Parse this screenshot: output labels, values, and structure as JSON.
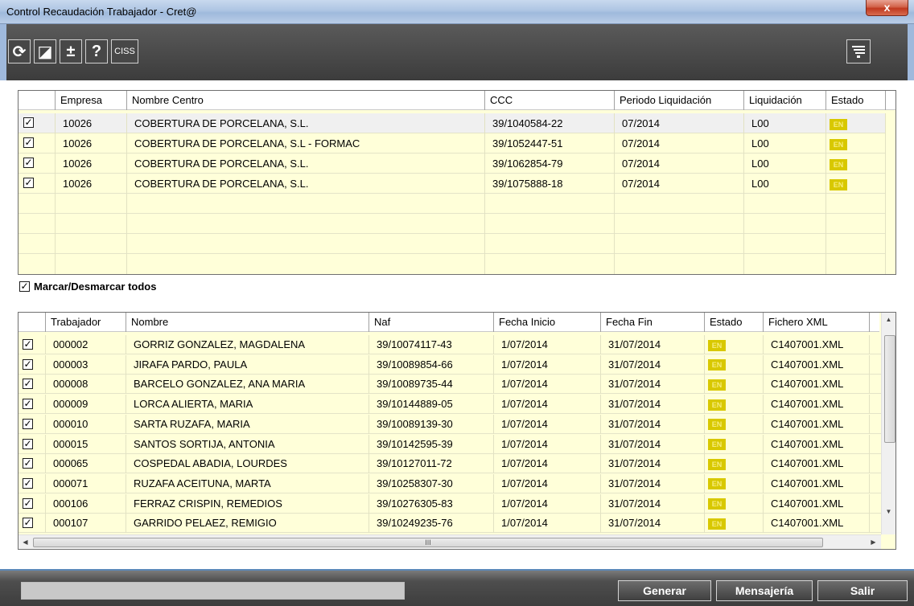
{
  "window": {
    "title": "Control Recaudación Trabajador - Cret@",
    "close_glyph": "x"
  },
  "toolbar": {
    "buttons": [
      {
        "icon": "refresh-icon",
        "glyph": "⟳"
      },
      {
        "icon": "edit-icon",
        "glyph": "◪"
      },
      {
        "icon": "plus-minus-icon",
        "glyph": "±"
      },
      {
        "icon": "help-icon",
        "glyph": "?"
      },
      {
        "icon": "ciss-icon",
        "glyph": "CISS"
      }
    ],
    "right_icon": "filter-icon"
  },
  "centers_grid": {
    "columns": [
      "Empresa",
      "Nombre Centro",
      "CCC",
      "Periodo Liquidación",
      "Liquidación",
      "Estado"
    ],
    "rows": [
      {
        "checked": true,
        "empresa": "10026",
        "nombre": "COBERTURA DE PORCELANA, S.L.",
        "ccc": "39/1040584-22",
        "periodo": "07/2014",
        "liquidacion": "L00",
        "estado": "EN"
      },
      {
        "checked": true,
        "empresa": "10026",
        "nombre": "COBERTURA DE PORCELANA, S.L - FORMAC",
        "ccc": "39/1052447-51",
        "periodo": "07/2014",
        "liquidacion": "L00",
        "estado": "EN"
      },
      {
        "checked": true,
        "empresa": "10026",
        "nombre": "COBERTURA DE PORCELANA, S.L.",
        "ccc": "39/1062854-79",
        "periodo": "07/2014",
        "liquidacion": "L00",
        "estado": "EN"
      },
      {
        "checked": true,
        "empresa": "10026",
        "nombre": "COBERTURA DE PORCELANA, S.L.",
        "ccc": "39/1075888-18",
        "periodo": "07/2014",
        "liquidacion": "L00",
        "estado": "EN"
      }
    ]
  },
  "marcar": {
    "label": "Marcar/Desmarcar todos",
    "checked": true
  },
  "workers_grid": {
    "columns": [
      "Trabajador",
      "Nombre",
      "Naf",
      "Fecha Inicio",
      "Fecha Fin",
      "Estado",
      "Fichero XML"
    ],
    "rows": [
      {
        "checked": true,
        "trabajador": "000002",
        "nombre": "GORRIZ GONZALEZ, MAGDALENA",
        "naf": "39/10074117-43",
        "inicio": "1/07/2014",
        "fin": "31/07/2014",
        "estado": "EN",
        "xml": "C1407001.XML"
      },
      {
        "checked": true,
        "trabajador": "000003",
        "nombre": "JIRAFA PARDO, PAULA",
        "naf": "39/10089854-66",
        "inicio": "1/07/2014",
        "fin": "31/07/2014",
        "estado": "EN",
        "xml": "C1407001.XML"
      },
      {
        "checked": true,
        "trabajador": "000008",
        "nombre": "BARCELO GONZALEZ, ANA MARIA",
        "naf": "39/10089735-44",
        "inicio": "1/07/2014",
        "fin": "31/07/2014",
        "estado": "EN",
        "xml": "C1407001.XML"
      },
      {
        "checked": true,
        "trabajador": "000009",
        "nombre": "LORCA ALIERTA, MARIA",
        "naf": "39/10144889-05",
        "inicio": "1/07/2014",
        "fin": "31/07/2014",
        "estado": "EN",
        "xml": "C1407001.XML"
      },
      {
        "checked": true,
        "trabajador": "000010",
        "nombre": "SARTA RUZAFA, MARIA",
        "naf": "39/10089139-30",
        "inicio": "1/07/2014",
        "fin": "31/07/2014",
        "estado": "EN",
        "xml": "C1407001.XML"
      },
      {
        "checked": true,
        "trabajador": "000015",
        "nombre": "SANTOS SORTIJA, ANTONIA",
        "naf": "39/10142595-39",
        "inicio": "1/07/2014",
        "fin": "31/07/2014",
        "estado": "EN",
        "xml": "C1407001.XML"
      },
      {
        "checked": true,
        "trabajador": "000065",
        "nombre": "COSPEDAL ABADIA, LOURDES",
        "naf": "39/10127011-72",
        "inicio": "1/07/2014",
        "fin": "31/07/2014",
        "estado": "EN",
        "xml": "C1407001.XML"
      },
      {
        "checked": true,
        "trabajador": "000071",
        "nombre": "RUZAFA ACEITUNA, MARTA",
        "naf": "39/10258307-30",
        "inicio": "1/07/2014",
        "fin": "31/07/2014",
        "estado": "EN",
        "xml": "C1407001.XML"
      },
      {
        "checked": true,
        "trabajador": "000106",
        "nombre": "FERRAZ CRISPIN, REMEDIOS",
        "naf": "39/10276305-83",
        "inicio": "1/07/2014",
        "fin": "31/07/2014",
        "estado": "EN",
        "xml": "C1407001.XML"
      },
      {
        "checked": true,
        "trabajador": "000107",
        "nombre": "GARRIDO PELAEZ, REMIGIO",
        "naf": "39/10249235-76",
        "inicio": "1/07/2014",
        "fin": "31/07/2014",
        "estado": "EN",
        "xml": "C1407001.XML"
      }
    ],
    "hscroll_grip": "III"
  },
  "footer": {
    "status_text": "",
    "buttons": {
      "generar": "Generar",
      "mensajeria": "Mensajería",
      "salir": "Salir"
    }
  },
  "colors": {
    "row_bg": "#ffffd9",
    "estado_badge": "#d8c800",
    "toolbar_bg": "#3c3c3c"
  }
}
